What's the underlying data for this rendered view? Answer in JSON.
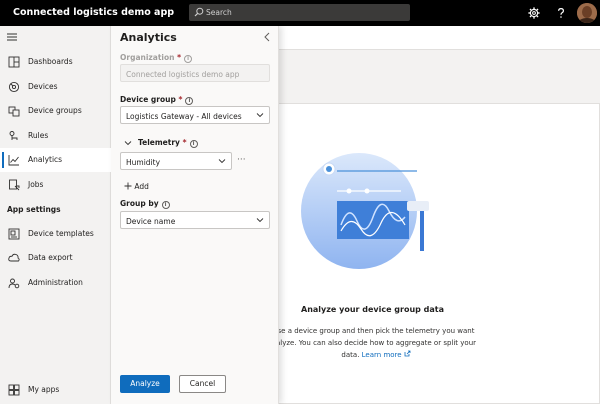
{
  "header": {
    "app_title": "Connected logistics demo app",
    "search_placeholder": "Search",
    "icons": [
      "gear-icon",
      "help-icon"
    ]
  },
  "nav": {
    "items": [
      {
        "label": "Dashboards",
        "icon": "dashboard-icon"
      },
      {
        "label": "Devices",
        "icon": "devices-icon"
      },
      {
        "label": "Device groups",
        "icon": "device-groups-icon"
      },
      {
        "label": "Rules",
        "icon": "rules-icon"
      },
      {
        "label": "Analytics",
        "icon": "analytics-icon",
        "active": true
      },
      {
        "label": "Jobs",
        "icon": "jobs-icon"
      }
    ],
    "section": "App settings",
    "settings_items": [
      {
        "label": "Device templates",
        "icon": "device-templates-icon"
      },
      {
        "label": "Data export",
        "icon": "data-export-icon"
      },
      {
        "label": "Administration",
        "icon": "administration-icon"
      }
    ],
    "footer_item": {
      "label": "My apps",
      "icon": "my-apps-icon"
    }
  },
  "panel": {
    "title": "Analytics",
    "organization_label": "Organization",
    "organization_value": "Connected logistics demo app",
    "device_group_label": "Device group",
    "device_group_value": "Logistics Gateway - All devices",
    "telemetry_label": "Telemetry",
    "telemetry_value": "Humidity",
    "more": "···",
    "add_label": "Add",
    "group_by_label": "Group by",
    "group_by_value": "Device name",
    "analyze_button": "Analyze",
    "cancel_button": "Cancel",
    "required_mark": "*",
    "info_glyph": "i"
  },
  "empty_state": {
    "title": "Analyze your device group data",
    "line1": "se a device group and then pick the telemetry you want",
    "line2": "alyze. You can also decide how to aggregate or split your",
    "line3": "data.",
    "learn_more": "Learn more"
  },
  "colors": {
    "accent": "#0f6cbd",
    "topbar": "#000000"
  }
}
